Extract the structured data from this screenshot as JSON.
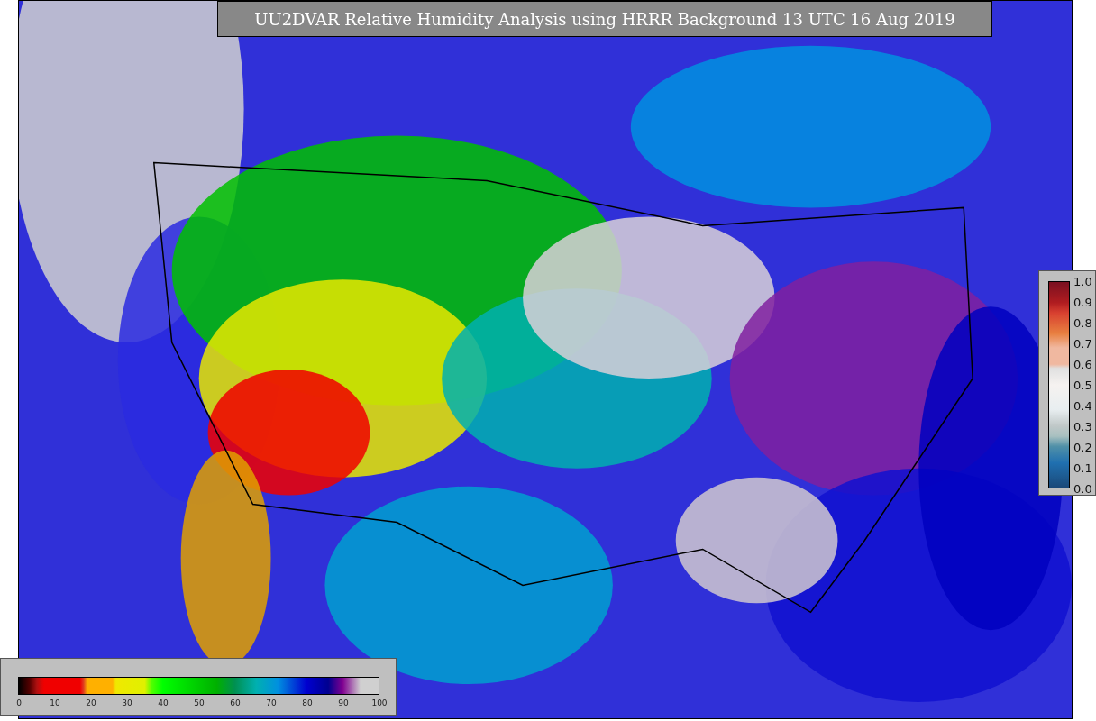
{
  "title": "UU2DVAR Relative Humidity Analysis using HRRR Background 13 UTC 16 Aug 2019",
  "humidity_colorbar": {
    "ticks": [
      "0",
      "10",
      "20",
      "30",
      "40",
      "50",
      "60",
      "70",
      "80",
      "90",
      "100"
    ]
  },
  "ratio_colorbar": {
    "ticks": [
      "1.0",
      "0.9",
      "0.8",
      "0.7",
      "0.6",
      "0.5",
      "0.4",
      "0.3",
      "0.2",
      "0.1",
      "0.0"
    ]
  }
}
